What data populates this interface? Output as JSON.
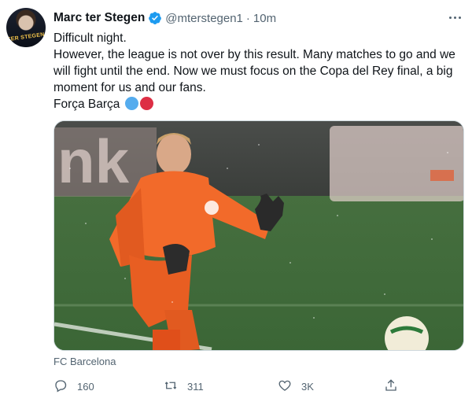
{
  "author": {
    "display_name": "Marc ter Stegen",
    "handle": "@mterstegen1",
    "separator": "·",
    "timestamp": "10m",
    "avatar_text": "TER STEGEN",
    "verified": true
  },
  "tweet": {
    "lines": [
      "Difficult night.",
      "However, the league is not over by this result. Many matches to go and we will fight until the end. Now we must focus on the Copa del Rey final, a big moment for us and our fans.",
      "Força Barça"
    ],
    "emoji_colors": [
      "#55acee",
      "#dd2e44"
    ]
  },
  "media": {
    "description_icon": "photo-goalkeeper",
    "banner_text": "nk"
  },
  "source": "FC Barcelona",
  "actions": {
    "reply": {
      "icon": "reply-icon",
      "count": "160"
    },
    "retweet": {
      "icon": "retweet-icon",
      "count": "311"
    },
    "like": {
      "icon": "heart-icon",
      "count": "3K"
    },
    "share": {
      "icon": "share-icon"
    }
  },
  "colors": {
    "verified": "#1d9bf0",
    "secondary_text": "#536471",
    "kit_orange": "#f26a2a"
  }
}
